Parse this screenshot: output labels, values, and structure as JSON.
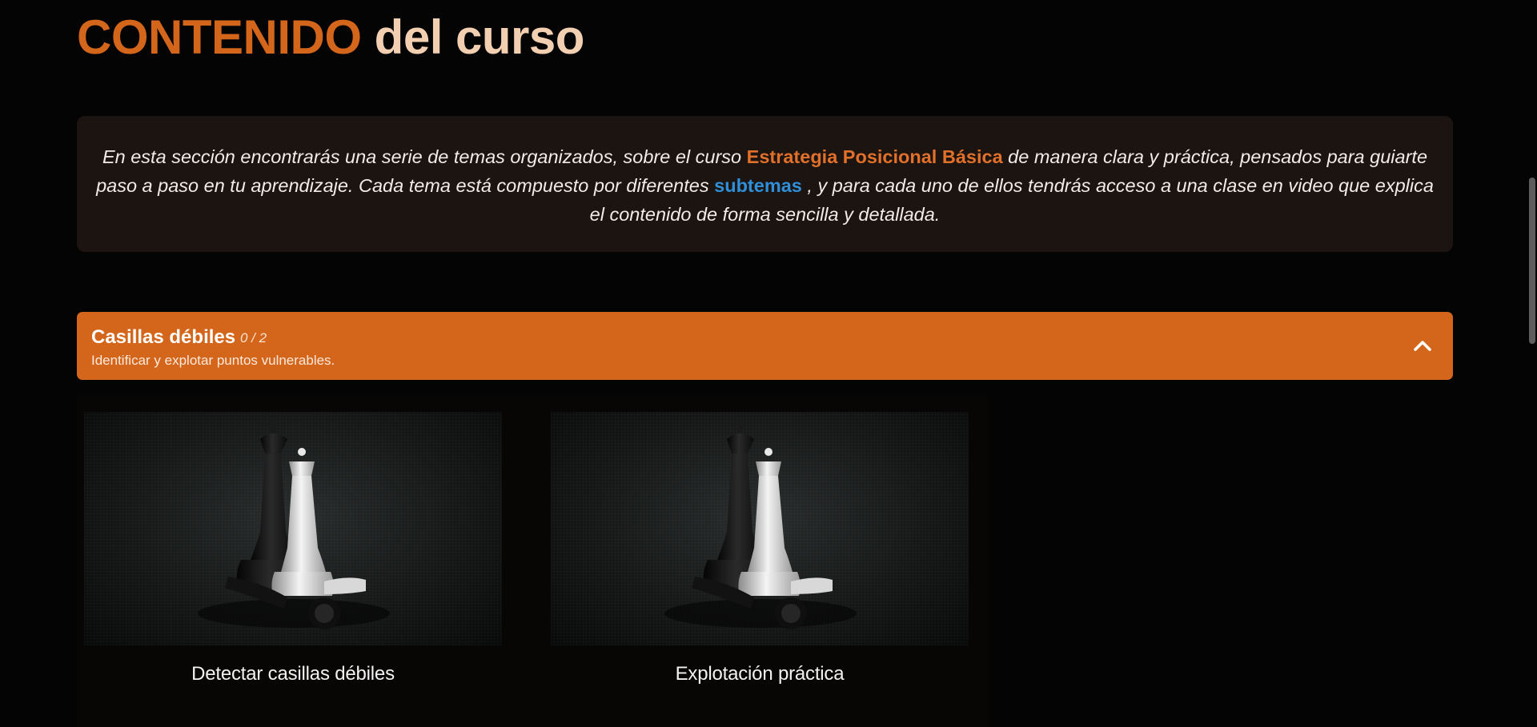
{
  "section_title": {
    "accent": "CONTENIDO",
    "rest": "del curso"
  },
  "intro": {
    "part1": "En esta sección encontrarás una serie de temas organizados, sobre el curso ",
    "course_name": "Estrategia Posicional Básica",
    "part2": " de manera clara y práctica, pensados para guiarte paso a paso en tu aprendizaje. Cada tema está compuesto por diferentes ",
    "subtopics_word": "subtemas",
    "part3": " , y para cada uno de ellos tendrás acceso a una clase en video que explica el contenido de forma sencilla y detallada."
  },
  "topic": {
    "title": "Casillas débiles",
    "progress": "0 / 2",
    "subtitle": "Identificar y explotar puntos vulnerables.",
    "toggle_icon": "chevron-up-icon"
  },
  "lessons": [
    {
      "caption": "Detectar casillas débiles",
      "thumbnail_icon": "chess-pieces-image"
    },
    {
      "caption": "Explotación práctica",
      "thumbnail_icon": "chess-pieces-image"
    }
  ],
  "colors": {
    "accent": "#d4661c",
    "title_rest": "#f3cfb2",
    "link_blue": "#2f8fd8",
    "intro_bg": "#1b1411",
    "page_bg": "#050404"
  }
}
